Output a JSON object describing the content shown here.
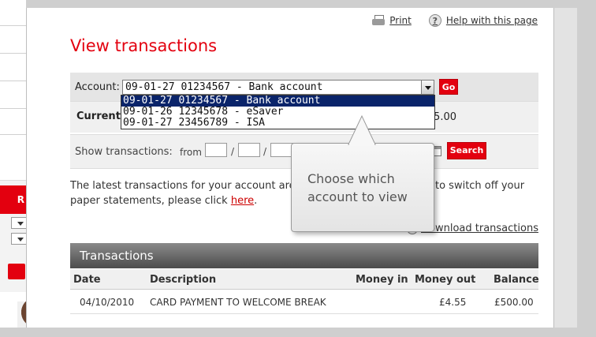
{
  "top_links": {
    "print": "Print",
    "help": "Help with this page"
  },
  "title": "View transactions",
  "account": {
    "label": "Account:",
    "selected": "09-01-27 01234567 - Bank account",
    "go_label": "Go",
    "options": [
      "09-01-27 01234567 - Bank account",
      "09-01-26 12345678 - eSaver",
      "09-01-27 23456789 - ISA"
    ]
  },
  "current": {
    "label": "Current b",
    "value": "5.00"
  },
  "show": {
    "label": "Show transactions:",
    "from_label": "from",
    "separator": "/",
    "search_label": "Search"
  },
  "info": {
    "line1_a": "The latest transactions for your account are",
    "line1_b": "ke to switch off your",
    "line2_a": "paper statements, please click",
    "here": "here",
    "line2_end": "."
  },
  "download_label": "Download transactions",
  "transactions": {
    "header": "Transactions",
    "columns": {
      "date": "Date",
      "description": "Description",
      "money_in": "Money in",
      "money_out": "Money out",
      "balance": "Balance"
    },
    "rows": [
      {
        "date": "04/10/2010",
        "description": "CARD PAYMENT TO WELCOME BREAK",
        "money_in": "",
        "money_out": "£4.55",
        "balance": "£500.00"
      }
    ]
  },
  "tooltip": {
    "text": "Choose which account to view"
  },
  "left_promo": {
    "banner_fragment": "R"
  },
  "colors": {
    "brand_red": "#e3000f",
    "header_grey": "#4c4c4c",
    "selected_option": "#0a246a"
  }
}
